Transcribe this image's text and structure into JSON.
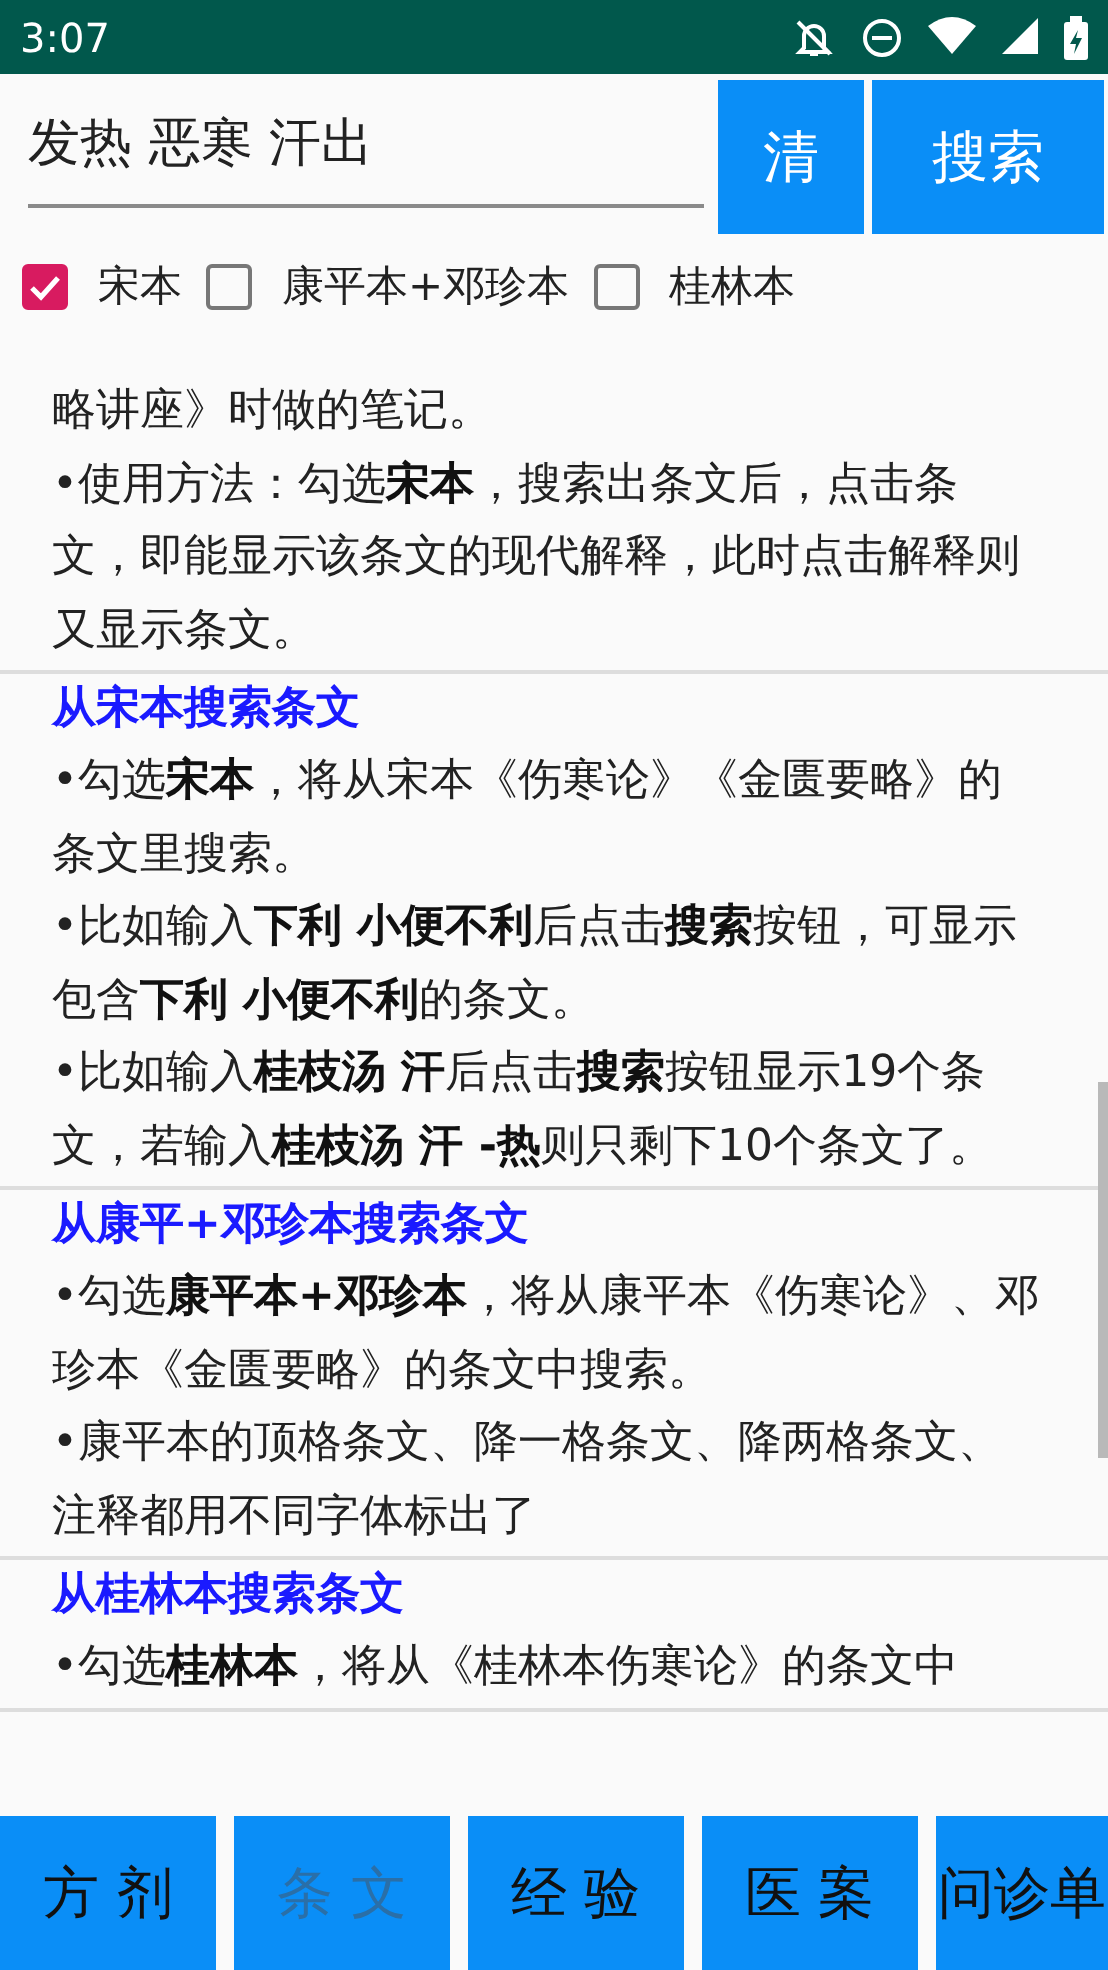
{
  "status_bar": {
    "time": "3:07"
  },
  "search": {
    "value": "发热 恶寒 汗出"
  },
  "search_buttons": [
    {
      "label": "清"
    },
    {
      "label": "搜索"
    }
  ],
  "sources": [
    {
      "label": "宋本",
      "checked": true
    },
    {
      "label": "康平本+邓珍本",
      "checked": false
    },
    {
      "label": "桂林本",
      "checked": false
    }
  ],
  "sections": [
    {
      "paragraphs": [
        "略讲座》时做的笔记。",
        "•使用方法：勾选**宋本**，搜索出条文后，点击条文，即能显示该条文的现代解释，此时点击解释则又显示条文。"
      ]
    },
    {
      "heading": "从宋本搜索条文",
      "paragraphs": [
        "•勾选**宋本**，将从宋本《伤寒论》《金匮要略》的条文里搜索。",
        "•比如输入**下利 小便不利**后点击**搜索**按钮，可显示包含**下利 小便不利**的条文。",
        "•比如输入**桂枝汤 汗**后点击**搜索**按钮显示19个条文，若输入**桂枝汤 汗 -热**则只剩下10个条文了。"
      ]
    },
    {
      "heading": "从康平+邓珍本搜索条文",
      "paragraphs": [
        "•勾选**康平本+邓珍本**，将从康平本《伤寒论》、邓珍本《金匮要略》的条文中搜索。",
        "•康平本的顶格条文、降一格条文、降两格条文、注释都用不同字体标出了"
      ]
    },
    {
      "heading": "从桂林本搜索条文",
      "paragraphs": [
        "•勾选**桂林本**，将从《桂林本伤寒论》的条文中"
      ]
    }
  ],
  "nav": [
    {
      "label": "方 剂",
      "selected": false
    },
    {
      "label": "条 文",
      "selected": true
    },
    {
      "label": "经 验",
      "selected": false
    },
    {
      "label": "医 案",
      "selected": false
    },
    {
      "label": "问诊单",
      "selected": false
    }
  ]
}
